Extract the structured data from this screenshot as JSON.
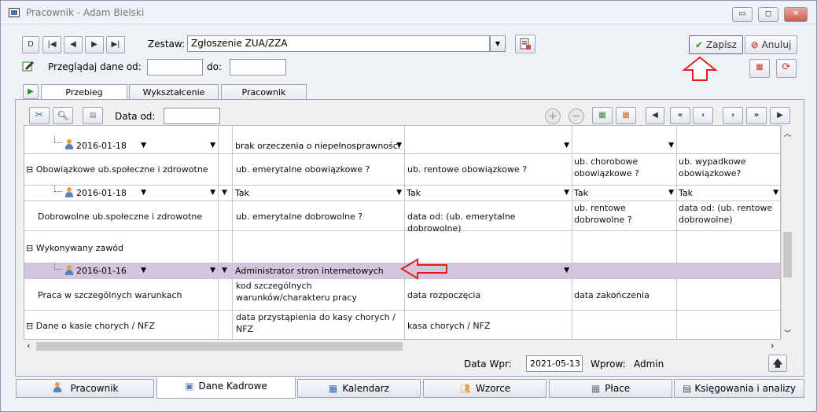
{
  "window": {
    "title": "Pracownik - Adam Bielski"
  },
  "toolbar": {
    "nav_buttons": [
      "D",
      "|◀",
      "◀",
      "▶",
      "▶|"
    ],
    "zestaw_label": "Zestaw:",
    "zestaw_value": "Zgłoszenie ZUA/ZZA",
    "przegladaj_label": "Przeglądaj dane od:",
    "do_label": "do:",
    "od_value": "",
    "do_value": "",
    "save_label": "Zapisz",
    "cancel_label": "Anuluj"
  },
  "top_tabs": [
    "Przebieg zatrudnie...",
    "Wykształcenie",
    "Pracownik"
  ],
  "grid_toolbar": {
    "data_od_label": "Data od:",
    "data_od_value": ""
  },
  "grid": {
    "row1": {
      "date": "2016-01-18",
      "c1": "brak orzeczenia o niepełnosprawności"
    },
    "row2": {
      "label": "Obowiązkowe ub.społeczne i zdrowotne",
      "c1": "ub. emerytalne obowiązkowe ?",
      "c2": "ub. rentowe obowiązkowe ?",
      "c3": "ub. chorobowe obowiązkowe ?",
      "c4": "ub. wypadkowe obowiązkowe?"
    },
    "row3": {
      "date": "2016-01-18",
      "c1": "Tak",
      "c2": "Tak",
      "c3": "Tak",
      "c4": "Tak"
    },
    "row4": {
      "label": "Dobrowolne ub.społeczne i zdrowotne",
      "c1": "ub. emerytalne dobrowolne ?",
      "c2": "data od: (ub. emerytalne dobrowolne)",
      "c3": "ub. rentowe dobrowolne ?",
      "c4": "data od: (ub. rentowe dobrowolne)"
    },
    "row5": {
      "label": "Wykonywany zawód"
    },
    "row6": {
      "date": "2016-01-16",
      "c1": "Administrator stron internetowych"
    },
    "row7": {
      "label": "Praca w szczególnych warunkach",
      "c1": "kod szczególnych warunków/charakteru pracy",
      "c2": "data rozpoczęcia",
      "c3": "data zakończenia"
    },
    "row8": {
      "label": "Dane o kasie chorych / NFZ",
      "c1": "data przystąpienia do kasy chorych / NFZ",
      "c2": "kasa chorych / NFZ"
    }
  },
  "footer": {
    "data_wpr_label": "Data Wpr:",
    "data_wpr_value": "2021-05-13",
    "wprow_label": "Wprow:",
    "wprow_value": "Admin"
  },
  "bottom_tabs": [
    "Pracownik",
    "Dane Kadrowe",
    "Kalendarz",
    "Wzorce",
    "Płace",
    "Księgowania i analizy"
  ],
  "colors": {
    "selected_row": "#d4c5de",
    "annotation_arrow": "#e02020"
  }
}
